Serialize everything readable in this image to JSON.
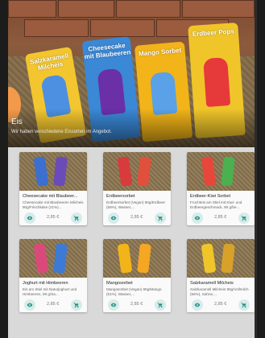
{
  "hero": {
    "title": "Eis",
    "subtitle": "Wir haben verschiedene Eissorten im Angebot.",
    "packs": [
      {
        "name": "Salzkaramell Milcheis",
        "color": "#f3c62f",
        "pop_color": "#4d8fe0"
      },
      {
        "name": "Cheesecake mit Blaubeeren",
        "color": "#3a88d6",
        "pop_color": "#6b2fa8"
      },
      {
        "name": "Mango Sorbet",
        "color": "#f2b418",
        "pop_color": "#5aa1e8"
      },
      {
        "name": "Erdbeer Pops",
        "color": "#f0c52a",
        "pop_color": "#e63a3a"
      }
    ]
  },
  "products": [
    {
      "title": "Cheesecake mit Blaubeer...",
      "desc": "Cheesecake mit Blaubeeren Milcheis 90g/Frischkäse (21%)...",
      "price": "2,85 €",
      "pop_colors": [
        "#3b6fd0",
        "#6a4bb8"
      ]
    },
    {
      "title": "Erdbeersorbet",
      "desc": "Erdbeersorbet (Vegan) 90g/Erdbeer (56%), Wasser,...",
      "price": "2,85 €",
      "pop_colors": [
        "#d83b3b",
        "#e0503c"
      ]
    },
    {
      "title": "Erdbeer-Kiwi Sorbet",
      "desc": "Fruchteis am Stiel mit Kiwi- und Erdbeergeschmack, 90 g/be...",
      "price": "2,85 €",
      "pop_colors": [
        "#e7473a",
        "#4caf50"
      ]
    },
    {
      "title": "Joghurt mit Himbeeren",
      "desc": "Eis am Stiel mit Naturjoghurt und Himbeeren, 90 g/Sa...",
      "price": "2,85 €",
      "pop_colors": [
        "#d94a7a",
        "#3c7ad6"
      ]
    },
    {
      "title": "Mangosorbet",
      "desc": "Mangosorbet (Vegan) 90g/Mango (51%), Wasser,...",
      "price": "2,85 €",
      "pop_colors": [
        "#f2b418",
        "#f5a623"
      ]
    },
    {
      "title": "Salzkaramell Milcheis",
      "desc": "Salzkaramell Milcheis 90g/Vollmilch (56%), Sahne,...",
      "price": "2,85 €",
      "pop_colors": [
        "#f0c52a",
        "#d7a12a"
      ]
    }
  ],
  "colors": {
    "accent": "#1b8a7e",
    "icon_bg": "#d7ecea"
  },
  "icons": {
    "view": "eye-icon",
    "cart": "shopping-cart-icon"
  }
}
